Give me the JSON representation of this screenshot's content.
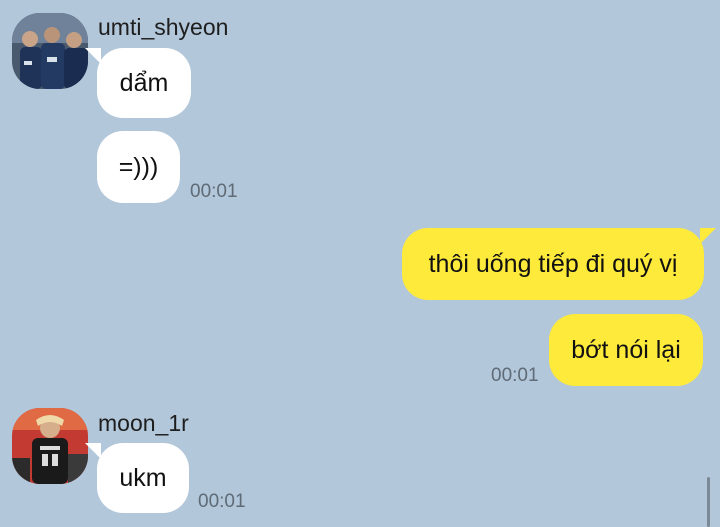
{
  "messages": [
    {
      "sender": "umti_shyeon",
      "avatar_icon": "team-photo-avatar-icon",
      "bubbles": [
        "dẩm",
        "=)))"
      ],
      "time": "00:01"
    },
    {
      "sender": "me",
      "bubbles": [
        "thôi uống tiếp đi quý vị",
        "bớt nói lại"
      ],
      "time": "00:01"
    },
    {
      "sender": "moon_1r",
      "avatar_icon": "player-jersey-avatar-icon",
      "bubbles": [
        "ukm"
      ],
      "time": "00:01"
    }
  ],
  "colors": {
    "background": "#b2c7da",
    "incoming_bubble": "#ffffff",
    "outgoing_bubble": "#fdea3b",
    "timestamp": "#5f6b76"
  }
}
